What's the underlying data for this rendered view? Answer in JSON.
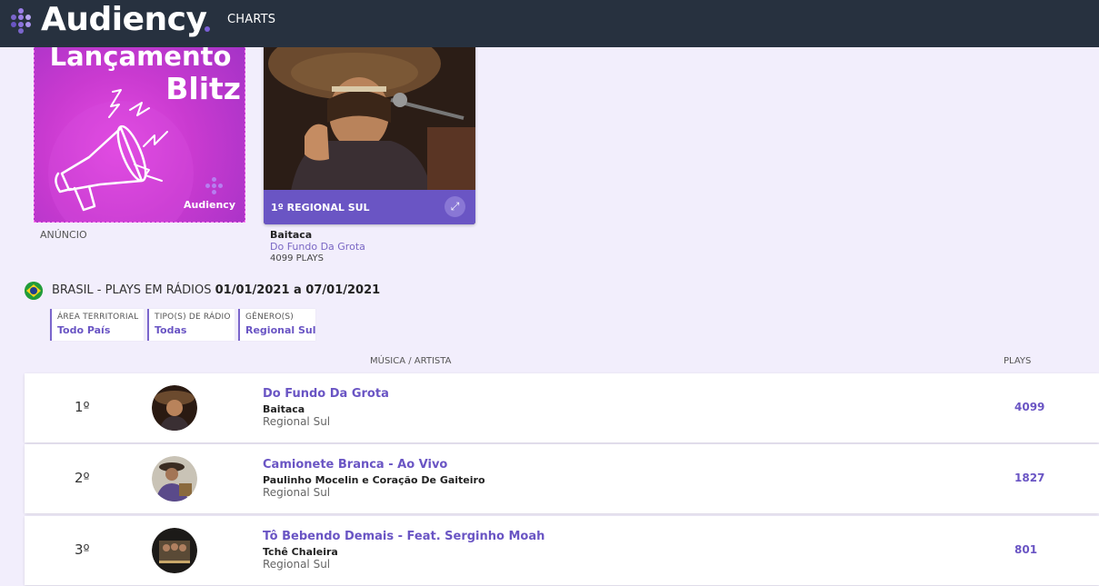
{
  "header": {
    "logo_text": "Audiency",
    "nav_charts": "CHARTS"
  },
  "ad": {
    "title_line1": "Lançamento",
    "title_line2": "Blitz",
    "brand": "Audiency",
    "label": "ANÚNCIO"
  },
  "featured": {
    "badge": "1º  REGIONAL SUL",
    "artist": "Baitaca",
    "song": "Do Fundo Da Grota",
    "plays": "4099 PLAYS"
  },
  "heading": {
    "prefix": "BRASIL - PLAYS EM RÁDIOS",
    "date_range": "01/01/2021 a 07/01/2021"
  },
  "filters": [
    {
      "label": "ÁREA TERRITORIAL",
      "value": "Todo País"
    },
    {
      "label": "TIPO(S) DE RÁDIO",
      "value": "Todas"
    },
    {
      "label": "GÊNERO(S)",
      "value": "Regional Sul"
    }
  ],
  "columns": {
    "song_artist": "MÚSICA / ARTISTA",
    "plays": "PLAYS"
  },
  "rows": [
    {
      "rank": "1º",
      "song": "Do Fundo Da Grota",
      "artist": "Baitaca",
      "genre": "Regional Sul",
      "plays": "4099"
    },
    {
      "rank": "2º",
      "song": "Camionete Branca - Ao Vivo",
      "artist": "Paulinho Mocelin e Coração De Gaiteiro",
      "genre": "Regional Sul",
      "plays": "1827"
    },
    {
      "rank": "3º",
      "song": "Tô Bebendo Demais - Feat. Serginho Moah",
      "artist": "Tchê Chaleira",
      "genre": "Regional Sul",
      "plays": "801"
    }
  ],
  "icons": {
    "flag": "brazil-flag-icon",
    "expand": "expand-icon",
    "megaphone": "megaphone-icon"
  },
  "colors": {
    "topbar": "#27313f",
    "accent": "#6a55c4",
    "background": "#f2eefc",
    "ad_magenta": "#c93ad0"
  }
}
